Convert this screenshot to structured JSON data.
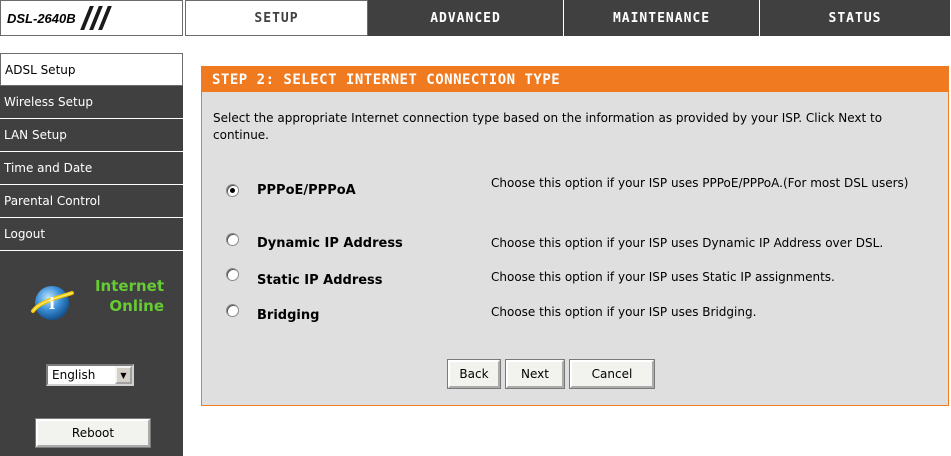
{
  "header": {
    "model": "DSL-2640B",
    "tabs": [
      {
        "label": "SETUP",
        "active": true
      },
      {
        "label": "ADVANCED",
        "active": false
      },
      {
        "label": "MAINTENANCE",
        "active": false
      },
      {
        "label": "STATUS",
        "active": false
      }
    ]
  },
  "sidebar": {
    "items": [
      {
        "label": "ADSL Setup",
        "active": true
      },
      {
        "label": "Wireless Setup",
        "active": false
      },
      {
        "label": "LAN Setup",
        "active": false
      },
      {
        "label": "Time and Date",
        "active": false
      },
      {
        "label": "Parental Control",
        "active": false
      },
      {
        "label": "Logout",
        "active": false
      }
    ],
    "status": {
      "line1": "Internet",
      "line2": "Online",
      "icon": "globe-info-icon"
    },
    "language": {
      "selected": "English"
    },
    "reboot_label": "Reboot"
  },
  "main": {
    "title": "STEP 2: SELECT INTERNET CONNECTION TYPE",
    "intro": "Select the appropriate Internet connection type based on the information as provided by your ISP. Click Next to continue.",
    "options": [
      {
        "label": "PPPoE/PPPoA",
        "description": "Choose this option if your ISP uses PPPoE/PPPoA.(For most DSL users)",
        "checked": true
      },
      {
        "label": "Dynamic IP Address",
        "description": "Choose this option if your ISP uses Dynamic IP Address over DSL.",
        "checked": false
      },
      {
        "label": "Static IP Address",
        "description": "Choose this option if your ISP uses Static IP assignments.",
        "checked": false
      },
      {
        "label": "Bridging",
        "description": "Choose this option if your ISP uses Bridging.",
        "checked": false
      }
    ],
    "buttons": {
      "back": "Back",
      "next": "Next",
      "cancel": "Cancel"
    }
  },
  "colors": {
    "accent_orange": "#f07a20",
    "nav_dark": "#404040",
    "panel_bg": "#dfdfdf",
    "status_green": "#66cc33"
  }
}
